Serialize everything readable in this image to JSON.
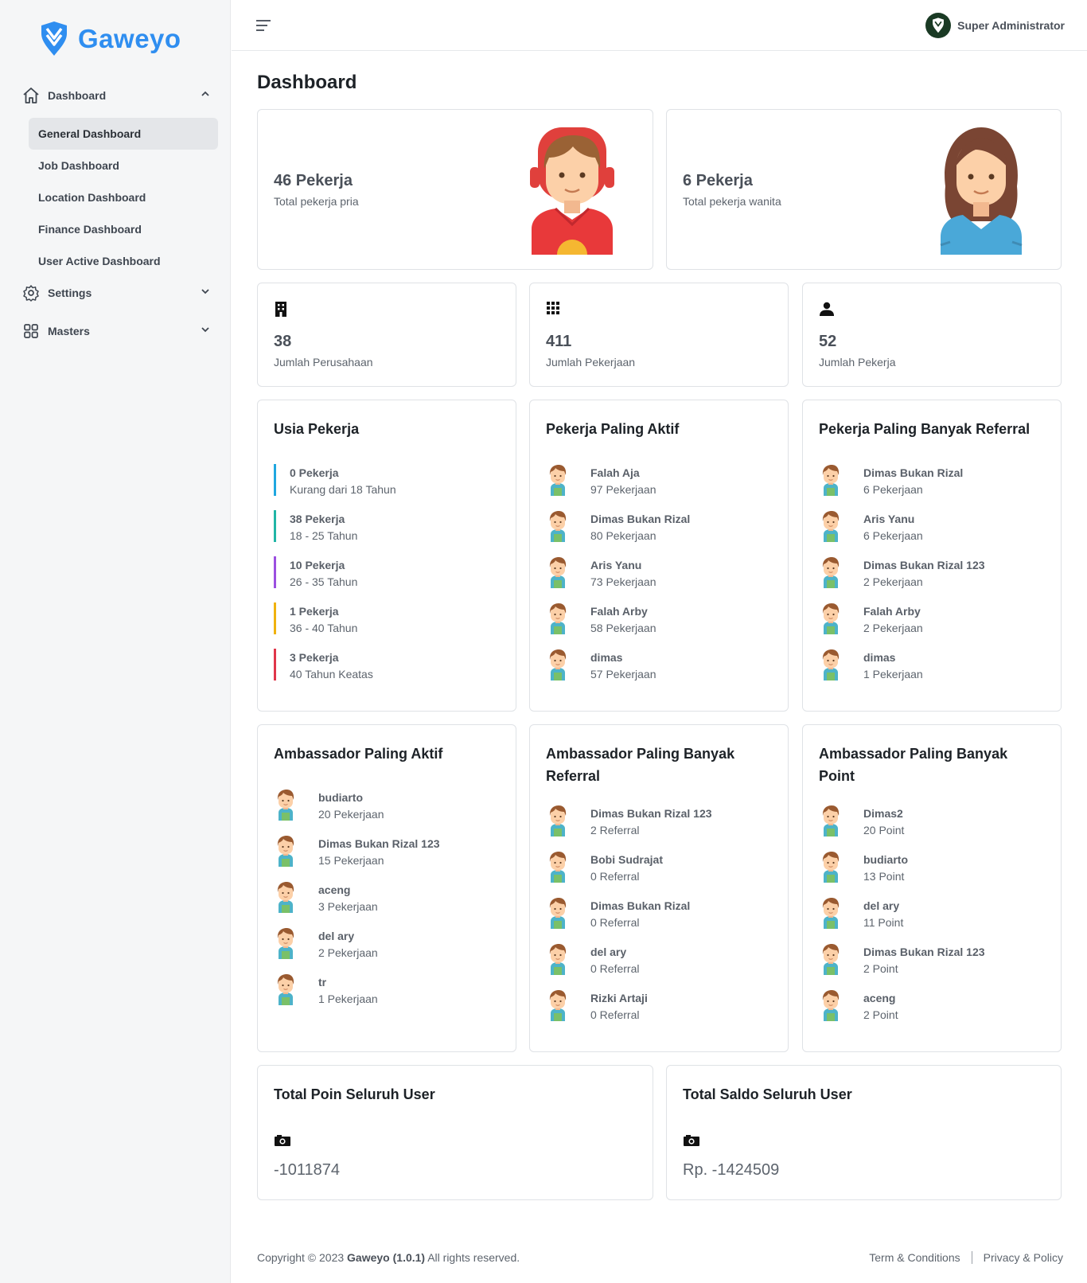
{
  "app": {
    "name": "Gaweyo"
  },
  "sidebar": {
    "dashboard_label": "Dashboard",
    "sub_items": [
      {
        "label": "General Dashboard"
      },
      {
        "label": "Job Dashboard"
      },
      {
        "label": "Location Dashboard"
      },
      {
        "label": "Finance Dashboard"
      },
      {
        "label": "User Active Dashboard"
      }
    ],
    "settings_label": "Settings",
    "masters_label": "Masters"
  },
  "header": {
    "user_name": "Super Administrator"
  },
  "page": {
    "title": "Dashboard"
  },
  "gender": {
    "male": {
      "count": "46 Pekerja",
      "label": "Total pekerja pria"
    },
    "female": {
      "count": "6 Pekerja",
      "label": "Total pekerja wanita"
    }
  },
  "stats": [
    {
      "value": "38",
      "label": "Jumlah Perusahaan",
      "icon": "building-icon"
    },
    {
      "value": "411",
      "label": "Jumlah Pekerjaan",
      "icon": "grid-icon"
    },
    {
      "value": "52",
      "label": "Jumlah Pekerja",
      "icon": "person-icon"
    }
  ],
  "age": {
    "title": "Usia Pekerja",
    "items": [
      {
        "count": "0 Pekerja",
        "range": "Kurang dari 18 Tahun",
        "color": "#1fa7e0"
      },
      {
        "count": "38 Pekerja",
        "range": "18 - 25 Tahun",
        "color": "#20b5a6"
      },
      {
        "count": "10 Pekerja",
        "range": "26 - 35 Tahun",
        "color": "#9b4fe0"
      },
      {
        "count": "1 Pekerja",
        "range": "36 - 40 Tahun",
        "color": "#f0b20e"
      },
      {
        "count": "3 Pekerja",
        "range": "40 Tahun Keatas",
        "color": "#e0364a"
      }
    ]
  },
  "active_workers": {
    "title": "Pekerja Paling Aktif",
    "items": [
      {
        "name": "Falah Aja",
        "value": "97 Pekerjaan"
      },
      {
        "name": "Dimas Bukan Rizal",
        "value": "80 Pekerjaan"
      },
      {
        "name": "Aris Yanu",
        "value": "73 Pekerjaan"
      },
      {
        "name": "Falah Arby",
        "value": "58 Pekerjaan"
      },
      {
        "name": "dimas",
        "value": "57 Pekerjaan"
      }
    ]
  },
  "referral_workers": {
    "title": "Pekerja Paling Banyak Referral",
    "items": [
      {
        "name": "Dimas Bukan Rizal",
        "value": "6 Pekerjaan"
      },
      {
        "name": "Aris Yanu",
        "value": "6 Pekerjaan"
      },
      {
        "name": "Dimas Bukan Rizal 123",
        "value": "2 Pekerjaan"
      },
      {
        "name": "Falah Arby",
        "value": "2 Pekerjaan"
      },
      {
        "name": "dimas",
        "value": "1 Pekerjaan"
      }
    ]
  },
  "active_ambassadors": {
    "title": "Ambassador Paling Aktif",
    "items": [
      {
        "name": "budiarto",
        "value": "20 Pekerjaan"
      },
      {
        "name": "Dimas Bukan Rizal 123",
        "value": "15 Pekerjaan"
      },
      {
        "name": "aceng",
        "value": "3 Pekerjaan"
      },
      {
        "name": "del ary",
        "value": "2 Pekerjaan"
      },
      {
        "name": "tr",
        "value": "1 Pekerjaan"
      }
    ]
  },
  "referral_ambassadors": {
    "title_line1": "Ambassador Paling Banyak",
    "title_line2": "Referral",
    "items": [
      {
        "name": "Dimas Bukan Rizal 123",
        "value": "2 Referral"
      },
      {
        "name": "Bobi Sudrajat",
        "value": "0 Referral"
      },
      {
        "name": "Dimas Bukan Rizal",
        "value": "0 Referral"
      },
      {
        "name": "del ary",
        "value": "0 Referral"
      },
      {
        "name": "Rizki Artaji",
        "value": "0 Referral"
      }
    ]
  },
  "point_ambassadors": {
    "title_line1": "Ambassador Paling Banyak",
    "title_line2": "Point",
    "items": [
      {
        "name": "Dimas2",
        "value": "20 Point"
      },
      {
        "name": "budiarto",
        "value": "13 Point"
      },
      {
        "name": "del ary",
        "value": "11 Point"
      },
      {
        "name": "Dimas Bukan Rizal 123",
        "value": "2 Point"
      },
      {
        "name": "aceng",
        "value": "2 Point"
      }
    ]
  },
  "totals": {
    "points": {
      "title": "Total Poin Seluruh User",
      "value": "-1011874"
    },
    "balance": {
      "title": "Total Saldo Seluruh User",
      "value": "Rp. -1424509"
    }
  },
  "footer": {
    "prefix": "Copyright © 2023 ",
    "brand": "Gaweyo (1.0.1)",
    "suffix": " All rights reserved.",
    "terms": "Term & Conditions",
    "privacy": "Privacy & Policy"
  },
  "colors": {
    "brand": "#2f8ef0",
    "active_bg": "#e4e6e9"
  }
}
